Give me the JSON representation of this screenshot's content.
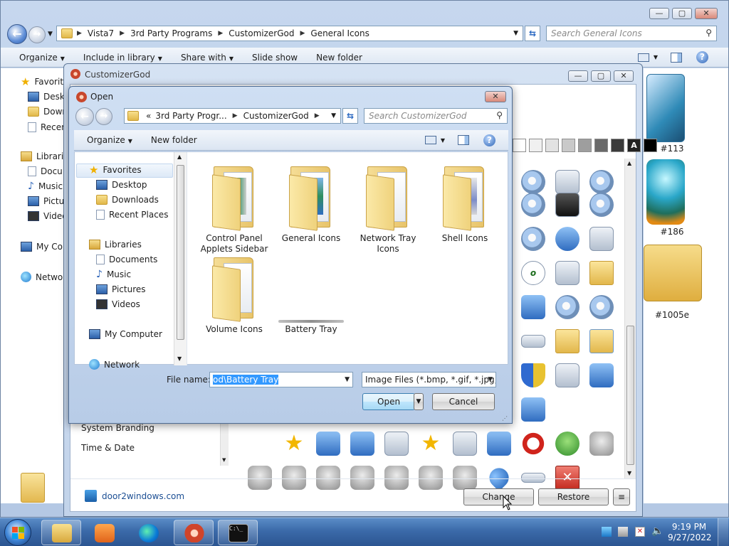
{
  "explorer": {
    "breadcrumb": [
      "Vista7",
      "3rd Party Programs",
      "CustomizerGod",
      "General Icons"
    ],
    "search_placeholder": "Search General Icons",
    "commands": [
      "Organize",
      "Include in library",
      "Share with",
      "Slide show",
      "New folder"
    ],
    "nav": {
      "favorites": "Favorites",
      "desktop": "Deskt",
      "downloads": "Down",
      "recent": "Recen",
      "libraries": "Librarie",
      "documents": "Docu",
      "music": "Music",
      "pictures": "Pictur",
      "videos": "Video",
      "computer": "My Cor",
      "network": "Networ"
    },
    "right_icons": [
      "#113",
      "#186",
      "#1005e"
    ]
  },
  "customizergod": {
    "title": "CustomizerGod",
    "sidebar": [
      "System Branding",
      "Time & Date"
    ],
    "footer_link": "door2windows.com",
    "change_label": "Change",
    "restore_label": "Restore",
    "menu_label": "≡",
    "tile_colors": [
      "#ffffff",
      "#f0f0f0",
      "#e2e2e2",
      "#c9c9c9",
      "#9e9e9e",
      "#6a6a6a",
      "#3a3a3a",
      "#222222",
      "#000000"
    ],
    "tile_letter": "A"
  },
  "open_dialog": {
    "title": "Open",
    "breadcrumb": [
      "«",
      "3rd Party Progr...",
      "CustomizerGod"
    ],
    "search_placeholder": "Search CustomizerGod",
    "organize": "Organize",
    "new_folder": "New folder",
    "nav": {
      "favorites": "Favorites",
      "desktop": "Desktop",
      "downloads": "Downloads",
      "recent": "Recent Places",
      "libraries": "Libraries",
      "documents": "Documents",
      "music": "Music",
      "pictures": "Pictures",
      "videos": "Videos",
      "computer": "My Computer",
      "network": "Network"
    },
    "items": [
      "Control Panel Applets Sidebar",
      "General Icons",
      "Network Tray Icons",
      "Shell Icons",
      "Volume Icons",
      "Battery Tray"
    ],
    "file_name_label": "File name:",
    "file_name_value": "od\\Battery Tray",
    "file_type": "Image Files (*.bmp, *.gif, *.jpg,",
    "open_label": "Open",
    "cancel_label": "Cancel"
  },
  "taskbar": {
    "time": "9:19 PM",
    "date": "9/27/2022"
  }
}
